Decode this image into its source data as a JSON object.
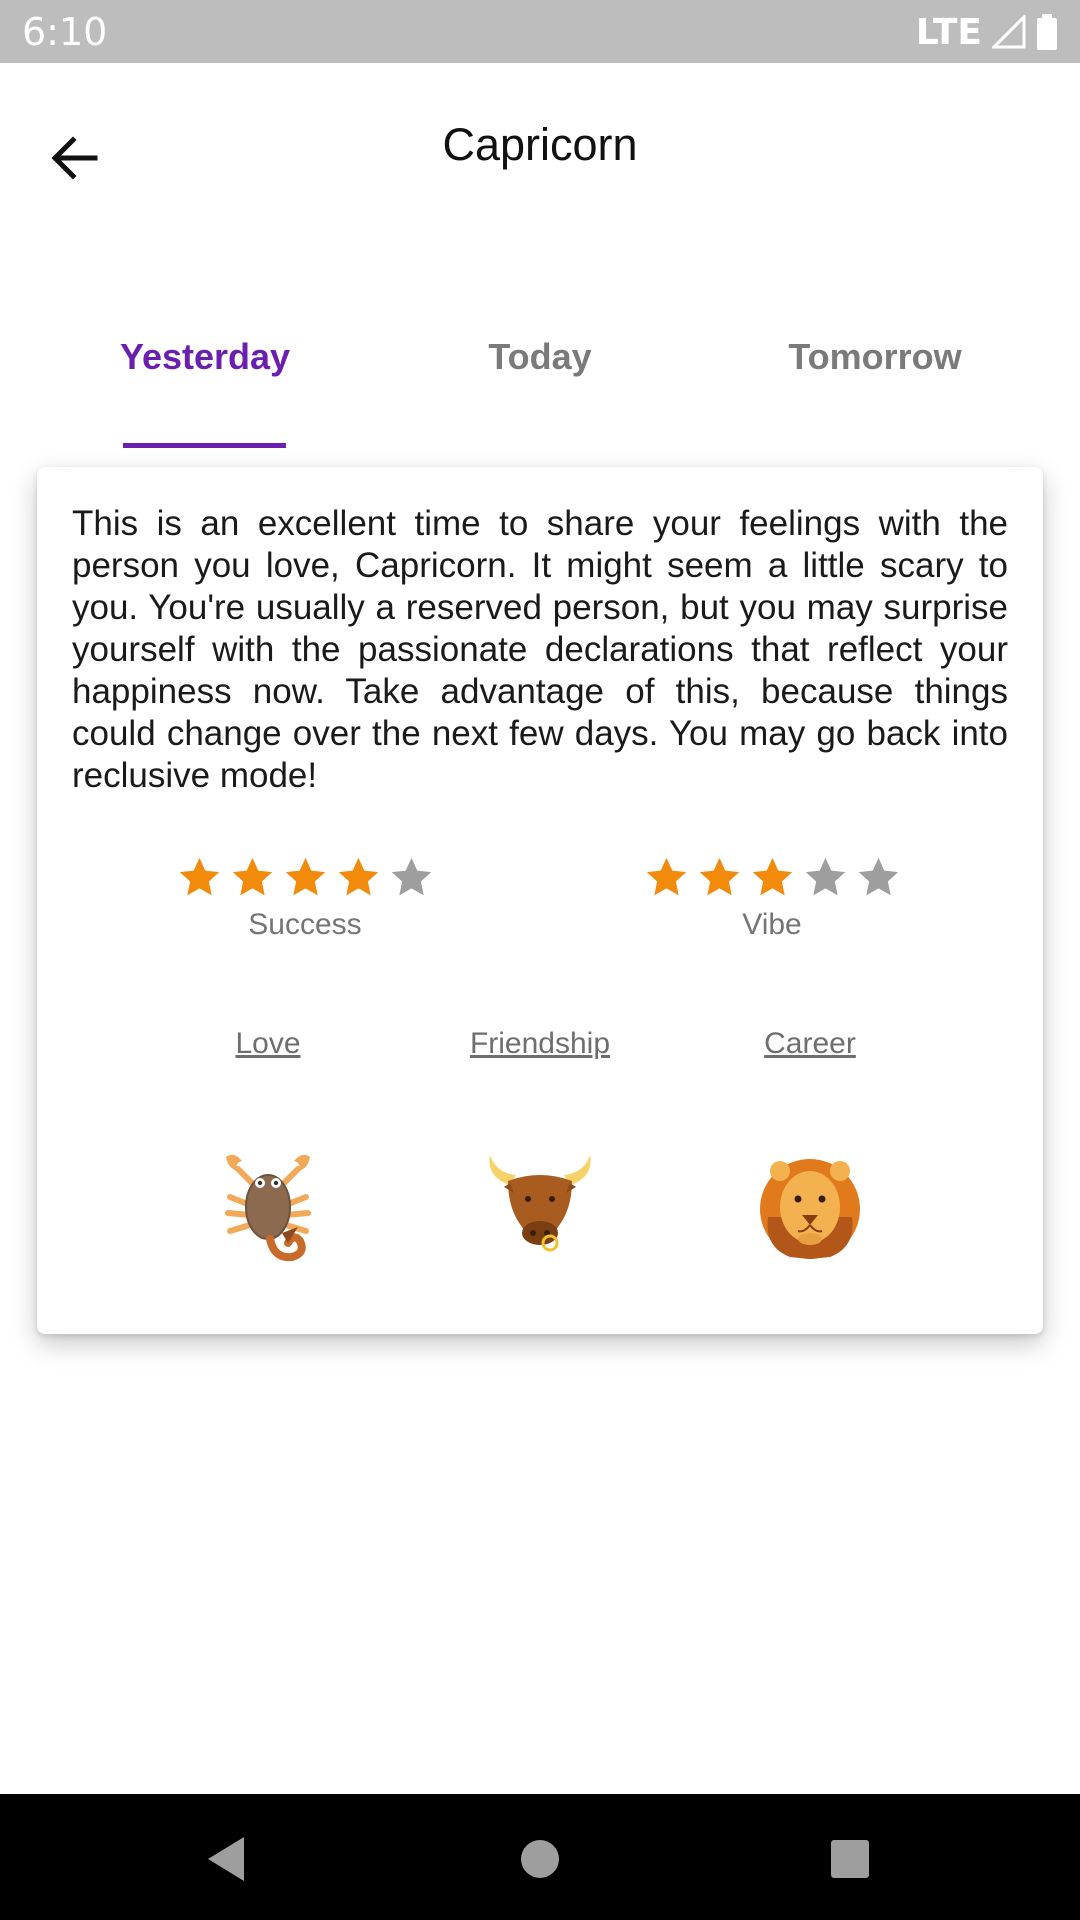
{
  "status_bar": {
    "time": "6:10",
    "network": "LTE"
  },
  "app_bar": {
    "title": "Capricorn"
  },
  "tabs": [
    {
      "label": "Yesterday",
      "active": true
    },
    {
      "label": "Today",
      "active": false
    },
    {
      "label": "Tomorrow",
      "active": false
    }
  ],
  "colors": {
    "accent": "#6a1fae",
    "star_on": "#f28b0c",
    "star_off": "#9e9e9e"
  },
  "horoscope": {
    "text": "This is an excellent time to share your feelings with the person you love, Capricorn. It might seem a little scary to you. You're usually a reserved person, but you may surprise yourself with the passionate declarations that reflect your happiness now. Take advantage of this, because things could change over the next few days. You may go back into reclusive mode!"
  },
  "ratings": [
    {
      "label": "Success",
      "stars": 4,
      "max": 5
    },
    {
      "label": "Vibe",
      "stars": 3,
      "max": 5
    }
  ],
  "compatibility": [
    {
      "label": "Love",
      "icon": "scorpion-icon"
    },
    {
      "label": "Friendship",
      "icon": "bull-icon"
    },
    {
      "label": "Career",
      "icon": "lion-icon"
    }
  ],
  "nav": {
    "back": "back-triangle-icon",
    "home": "home-circle-icon",
    "recents": "recents-square-icon"
  }
}
